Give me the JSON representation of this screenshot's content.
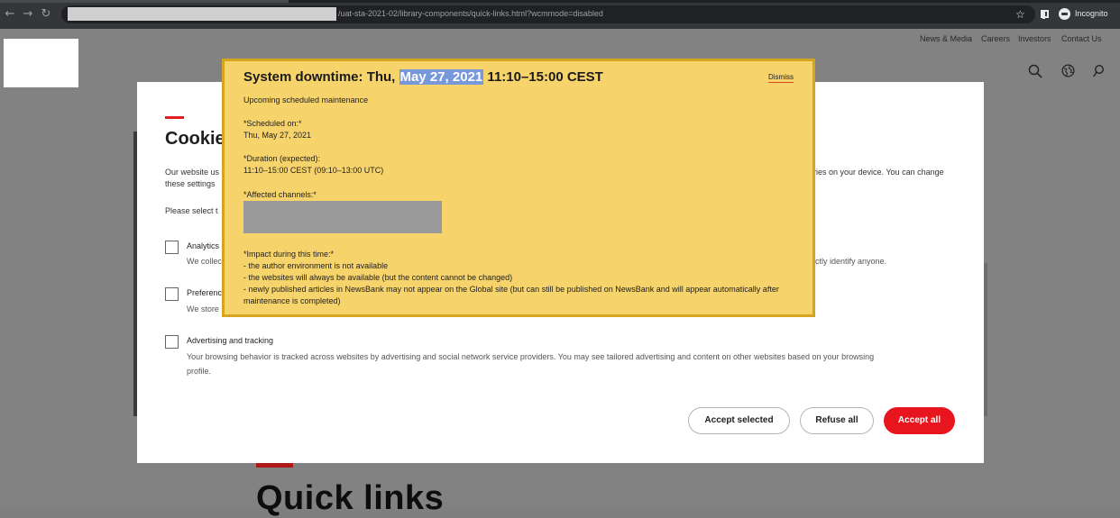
{
  "browser": {
    "url": "/uat-sta-2021-02/library-components/quick-links.html?wcmmode=disabled",
    "profile_label": "Incognito",
    "back_icon": "arrow-left-icon",
    "forward_icon": "arrow-right-icon",
    "reload_icon": "reload-icon",
    "bookmark_icon": "star-icon",
    "sidepanel_icon": "side-panel-icon",
    "profile_icon": "incognito-icon"
  },
  "header": {
    "utility_links": [
      "News & Media",
      "Careers",
      "Investors",
      "Contact Us"
    ],
    "icons": [
      "search-icon",
      "globe-icon",
      "user-icon"
    ]
  },
  "background_page": {
    "section_title": "Quick links"
  },
  "cookie_dialog": {
    "title": "Cookie",
    "intro_line1_start": "Our website us",
    "intro_line1_end": "ries on your device. You can change",
    "intro_line2": "these settings",
    "select_prompt": "Please select t",
    "categories": [
      {
        "title": "Analytics",
        "desc_start": "We collec",
        "desc_end": "ctly identify anyone."
      },
      {
        "title": "Preferenc",
        "desc_start": "We store"
      },
      {
        "title": "Advertising and tracking",
        "desc_line1": "Your browsing behavior is tracked across websites by advertising and social network service providers. You may see tailored advertising and content on other websites based on your browsing",
        "desc_line2": "profile."
      }
    ],
    "buttons": {
      "accept_selected": "Accept selected",
      "refuse_all": "Refuse all",
      "accept_all": "Accept all"
    },
    "colors": {
      "accent": "#e8141e"
    }
  },
  "banner": {
    "title_prefix": "System downtime: Thu, ",
    "title_highlight": "May 27, 2021",
    "title_suffix": " 11:10–15:00 CEST",
    "dismiss_label": "Dismiss",
    "subtitle": "Upcoming scheduled maintenance",
    "scheduled_label": "*Scheduled on:*",
    "scheduled_value": "Thu, May 27, 2021",
    "duration_label": "*Duration (expected):",
    "duration_value": "11:10–15:00 CEST (09:10–13:00 UTC)",
    "channels_label": "*Affected channels:*",
    "impact_label": "*Impact during this time:*",
    "impact_items": [
      "- the author environment is not available",
      "- the websites will always be available (but the content cannot be changed)",
      "- newly published articles in NewsBank may not appear on the Global site (but can still be published on NewsBank and will appear automatically after",
      "maintenance is completed)"
    ],
    "colors": {
      "background": "#f6d36b",
      "border": "#d6a520",
      "highlight": "#7799dc"
    }
  }
}
